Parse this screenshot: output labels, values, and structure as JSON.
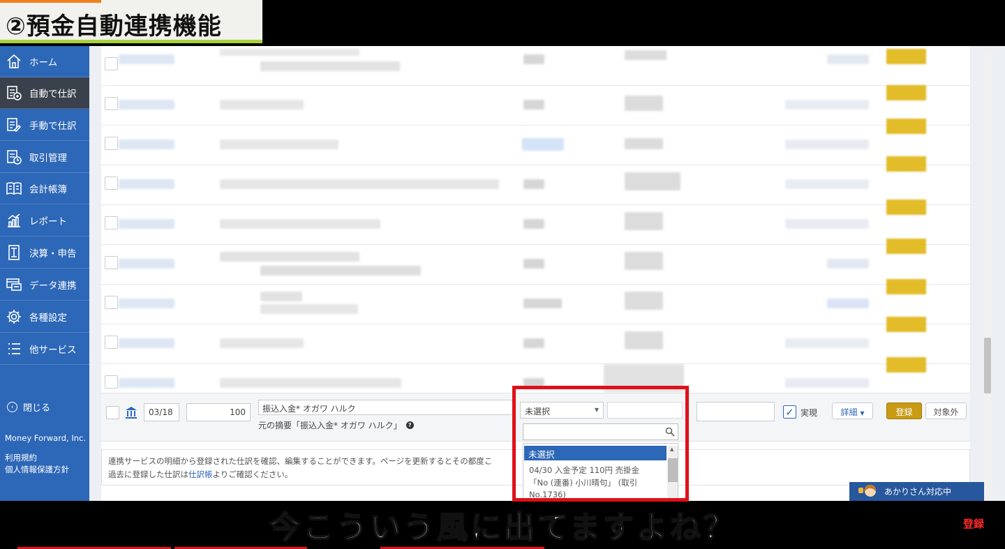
{
  "video": {
    "title": "②預金自動連携機能",
    "caption": "今こういう風に出てますよね？",
    "subscribe_badge": "登録"
  },
  "sidebar": {
    "items": [
      {
        "label": "ホーム",
        "icon": "home-icon"
      },
      {
        "label": "自動で仕訳",
        "icon": "auto-journal-icon",
        "active": true
      },
      {
        "label": "手動で仕訳",
        "icon": "manual-journal-icon"
      },
      {
        "label": "取引管理",
        "icon": "transaction-icon"
      },
      {
        "label": "会計帳簿",
        "icon": "ledger-icon"
      },
      {
        "label": "レポート",
        "icon": "report-icon"
      },
      {
        "label": "決算・申告",
        "icon": "settlement-icon"
      },
      {
        "label": "データ連携",
        "icon": "data-link-icon"
      },
      {
        "label": "各種設定",
        "icon": "gear-icon"
      },
      {
        "label": "他サービス",
        "icon": "list-icon"
      }
    ],
    "close_label": "閉じる",
    "company": "Money Forward, Inc.",
    "terms": "利用規約",
    "privacy": "個人情報保護方針"
  },
  "entry": {
    "date": "03/18",
    "amount": "100",
    "memo": "振込入金* オガワ ハルク",
    "original_memo": "元の摘要「振込入金* オガワ ハルク」",
    "select_value": "未選択",
    "jitsugen_label": "実現",
    "detail_label": "詳細",
    "register_label": "登録",
    "exclude_label": "対象外"
  },
  "dropdown": {
    "selected": "未選択",
    "option_line1": "04/30 入金予定 110円 売掛金",
    "option_line2": "「No (連番) 小川晴句」 (取引",
    "option_line3": "No.1736)"
  },
  "info": {
    "line1": "連携サービスの明細から登録された仕訳を確認、編集することができます。ページを更新するとその都度こ",
    "line2_prefix": "過去に登録した仕訳は",
    "line2_link": "仕訳帳",
    "line2_suffix": "よりご確認ください。"
  },
  "chat": {
    "label": "あかりさん対応中"
  },
  "colors": {
    "sidebar": "#2d67b7",
    "active_item": "#3b414c",
    "register_button": "#c99a14",
    "highlight_frame": "#e01018"
  }
}
